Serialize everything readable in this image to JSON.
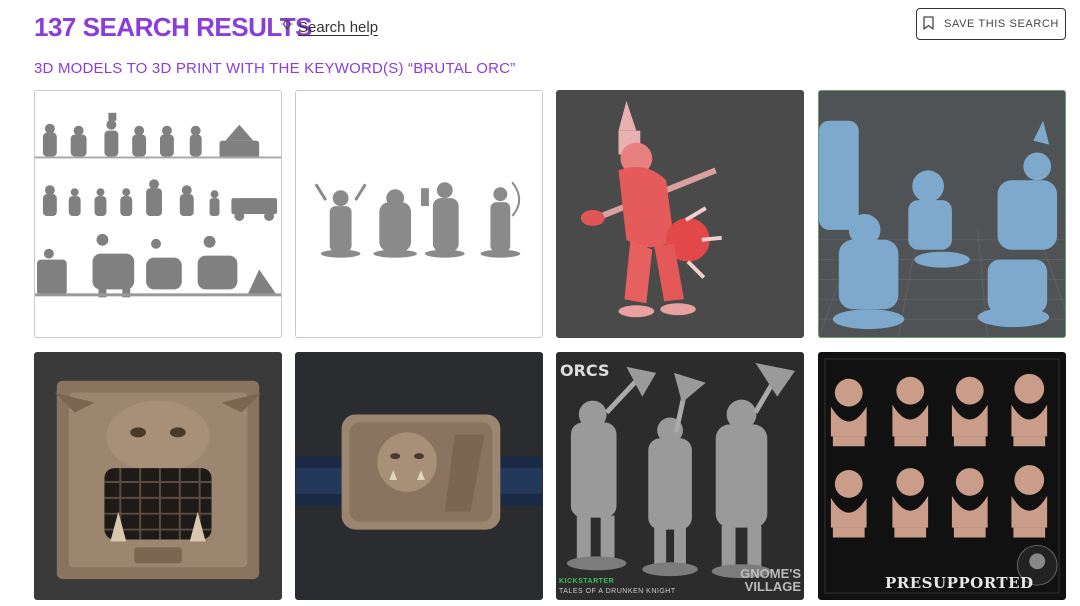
{
  "header": {
    "title": "137 SEARCH RESULTS",
    "search_help": "Search help",
    "save_button": "SAVE THIS SEARCH",
    "subtitle": "3D MODELS TO 3D PRINT WITH THE KEYWORD(S) “BRUTAL ORC”"
  },
  "colors": {
    "accent": "#8a3ddc",
    "text": "#333333"
  },
  "icons": {
    "help": "lightbulb-icon",
    "save": "bookmark-icon"
  },
  "results": [
    {
      "overlays": []
    },
    {
      "overlays": []
    },
    {
      "overlays": []
    },
    {
      "overlays": []
    },
    {
      "overlays": []
    },
    {
      "overlays": []
    },
    {
      "overlays": [
        "ORCS",
        "GNOME'S",
        "VILLAGE",
        "KICKSTARTER",
        "TALES OF A DRUNKEN KNIGHT"
      ]
    },
    {
      "overlays": [
        "PRESUPPORTED"
      ]
    }
  ]
}
